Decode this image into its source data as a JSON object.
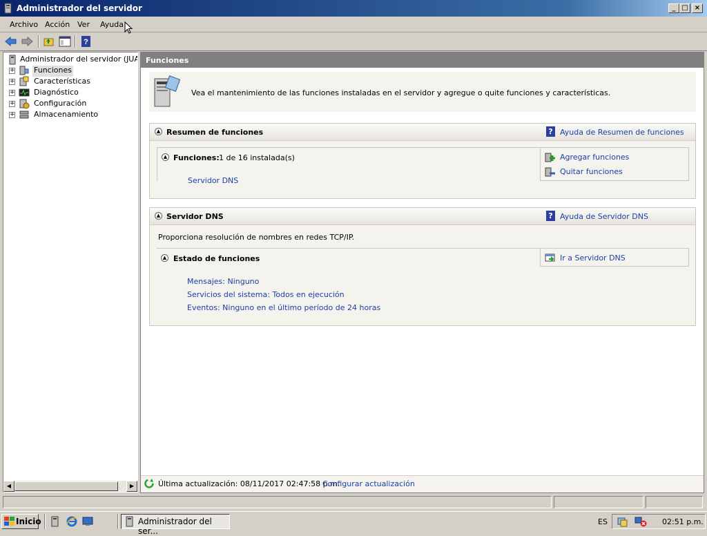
{
  "window": {
    "title": "Administrador del servidor"
  },
  "menu": [
    "Archivo",
    "Acción",
    "Ver",
    "Ayuda"
  ],
  "tree": {
    "root": "Administrador del servidor (JUAN-R",
    "items": [
      "Funciones",
      "Características",
      "Diagnóstico",
      "Configuración",
      "Almacenamiento"
    ]
  },
  "header": {
    "title": "Funciones"
  },
  "intro": {
    "text": "Vea el mantenimiento de las funciones instaladas en el servidor y agregue o quite funciones y características."
  },
  "summary": {
    "title": "Resumen de funciones",
    "help_link": "Ayuda de Resumen de funciones",
    "roles_label": "Funciones:",
    "roles_count": "1 de 16 instalada(s)",
    "role_link": "Servidor DNS",
    "add_link": "Agregar funciones",
    "remove_link": "Quitar funciones"
  },
  "dns": {
    "title": "Servidor DNS",
    "help_link": "Ayuda de Servidor DNS",
    "description": "Proporciona resolución de nombres en redes TCP/IP.",
    "status_title": "Estado de funciones",
    "go_link": "Ir a Servidor DNS",
    "messages": "Mensajes: Ninguno",
    "services": "Servicios del sistema: Todos en ejecución",
    "events": "Eventos: Ninguno en el último período de 24 horas"
  },
  "status": {
    "last_update": "Última actualización: 08/11/2017 02:47:58 p.m.",
    "configure_link": "Configurar actualización"
  },
  "taskbar": {
    "start": "Inicio",
    "task": "Administrador del ser...",
    "lang": "ES",
    "clock": "02:51 p.m."
  },
  "colors": {
    "titlebar": "#0a246a",
    "link": "#1a3fa8",
    "header": "#808080"
  }
}
